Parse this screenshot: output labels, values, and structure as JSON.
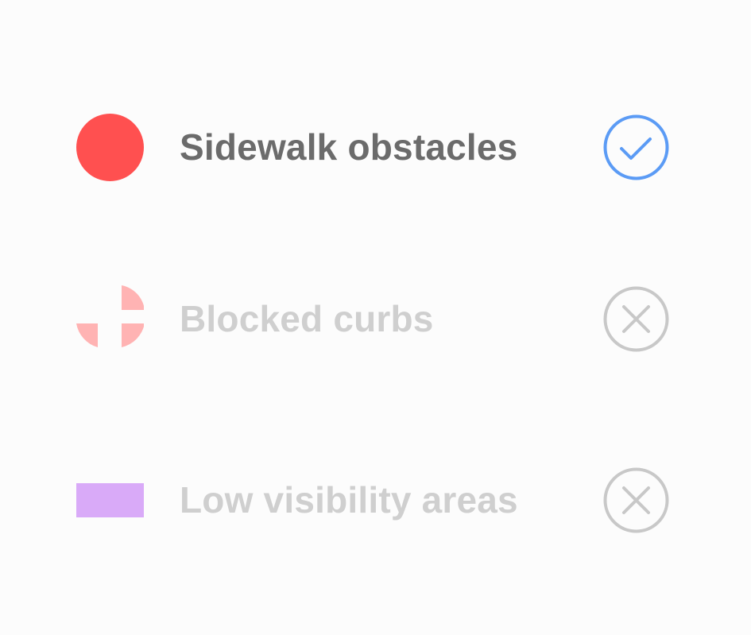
{
  "legend": {
    "items": [
      {
        "label": "Sidewalk obstacles",
        "symbol": "red-circle-icon",
        "color": "#ff5050",
        "state": "selected",
        "state_icon": "check-circle-icon",
        "state_color": "#5b9bf5"
      },
      {
        "label": "Blocked curbs",
        "symbol": "quartered-circle-icon",
        "color": "#ffb3b3",
        "state": "deselected",
        "state_icon": "x-circle-icon",
        "state_color": "#c8c8c8"
      },
      {
        "label": "Low visibility areas",
        "symbol": "purple-rectangle-icon",
        "color": "#d9aaf8",
        "state": "deselected",
        "state_icon": "x-circle-icon",
        "state_color": "#c8c8c8"
      }
    ]
  },
  "colors": {
    "background": "#fcfcfc",
    "active_text": "#6b6b6b",
    "inactive_text": "#cfcfcf"
  }
}
